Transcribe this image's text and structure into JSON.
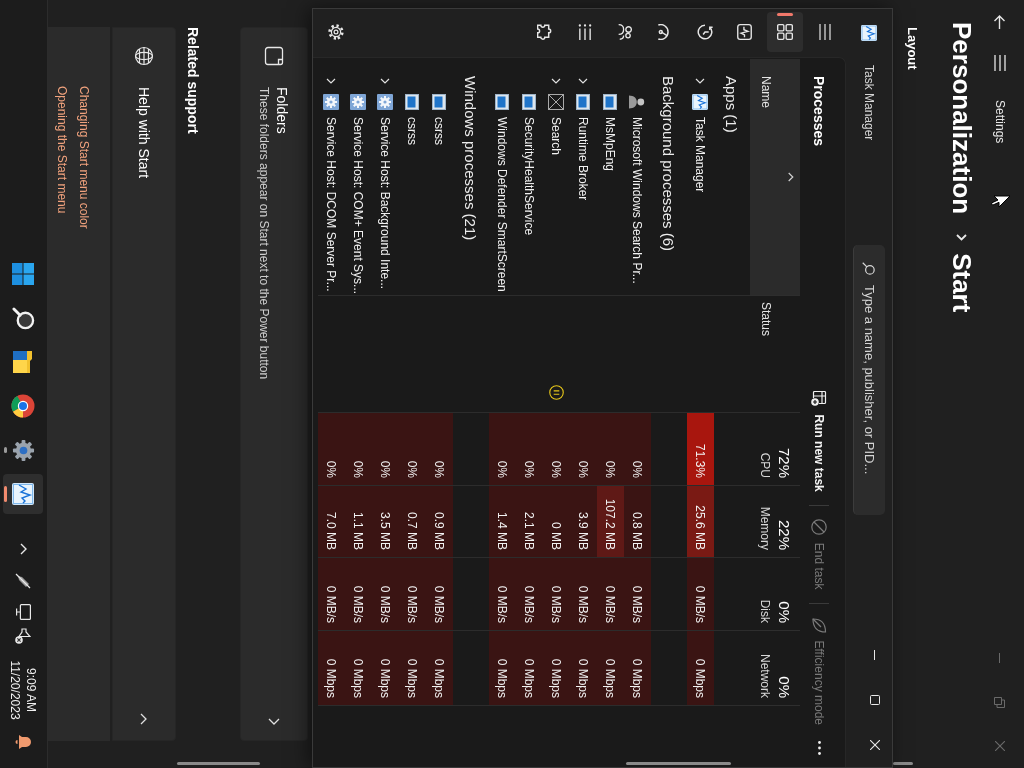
{
  "settings_window": {
    "title": "Settings",
    "breadcrumb": {
      "parent": "Personalization",
      "current": "Start"
    },
    "section_heading": "Layout",
    "folders_card": {
      "title": "Folders",
      "description": "These folders appear on Start next to the Power button"
    },
    "related_heading": "Related support",
    "help_card": {
      "title": "Help with Start",
      "expanded": true,
      "links": [
        "Changing Start menu color",
        "Opening the Start menu"
      ]
    }
  },
  "task_manager": {
    "title": "Task Manager",
    "search": {
      "placeholder": "Type a name, publisher, or PID..."
    },
    "nav": [
      {
        "selected": true
      },
      {
        "selected": false
      },
      {
        "selected": false
      },
      {
        "selected": false
      },
      {
        "selected": false
      },
      {
        "selected": false
      },
      {
        "selected": false
      },
      {
        "selected": false
      }
    ],
    "page_title": "Processes",
    "toolbar": [
      {
        "label": "Run new task",
        "disabled": false
      },
      {
        "label": "End task",
        "disabled": true
      },
      {
        "label": "Efficiency mode",
        "disabled": true
      }
    ],
    "columns": [
      {
        "label": "Name",
        "sorted": true
      },
      {
        "label": "Status",
        "sorted": false
      },
      {
        "label": "CPU",
        "total": "72%",
        "sorted": false
      },
      {
        "label": "Memory",
        "total": "22%",
        "sorted": false
      },
      {
        "label": "Disk",
        "total": "0%",
        "sorted": false
      },
      {
        "label": "Network",
        "total": "0%",
        "sorted": false
      }
    ],
    "groups": [
      {
        "label": "Apps (1)",
        "rows": [
          {
            "name": "Task Manager",
            "kind": "chart",
            "expandable": true,
            "suspended": false,
            "values": [
              {
                "text": "71.3%",
                "color": "#a8160e"
              },
              {
                "text": "25.6 MB",
                "color": "#7a1a14"
              },
              {
                "text": "0 MB/s",
                "color": "#3a1413"
              },
              {
                "text": "0 Mbps",
                "color": "#3a1413"
              }
            ]
          }
        ]
      },
      {
        "label": "Background processes (6)",
        "rows": [
          {
            "name": "Microsoft Windows Search Pr...",
            "kind": "person",
            "expandable": false,
            "suspended": false,
            "values": [
              {
                "text": "0%",
                "color": "#3a1413"
              },
              {
                "text": "0.8 MB",
                "color": "#3a1413"
              },
              {
                "text": "0 MB/s",
                "color": "#3a1413"
              },
              {
                "text": "0 Mbps",
                "color": "#3a1413"
              }
            ]
          },
          {
            "name": "MsMpEng",
            "kind": "window",
            "expandable": false,
            "suspended": false,
            "values": [
              {
                "text": "0%",
                "color": "#3a1413"
              },
              {
                "text": "107.2 MB",
                "color": "#5f1916"
              },
              {
                "text": "0 MB/s",
                "color": "#3a1413"
              },
              {
                "text": "0 Mbps",
                "color": "#3a1413"
              }
            ]
          },
          {
            "name": "Runtime Broker",
            "kind": "window",
            "expandable": true,
            "suspended": false,
            "values": [
              {
                "text": "0%",
                "color": "#3a1413"
              },
              {
                "text": "3.9 MB",
                "color": "#3a1413"
              },
              {
                "text": "0 MB/s",
                "color": "#3a1413"
              },
              {
                "text": "0 Mbps",
                "color": "#3a1413"
              }
            ]
          },
          {
            "name": "Search",
            "kind": "missing",
            "expandable": true,
            "suspended": true,
            "values": [
              {
                "text": "0%",
                "color": "#3a1413"
              },
              {
                "text": "0 MB",
                "color": "#3a1413"
              },
              {
                "text": "0 MB/s",
                "color": "#3a1413"
              },
              {
                "text": "0 Mbps",
                "color": "#3a1413"
              }
            ]
          },
          {
            "name": "SecurityHealthService",
            "kind": "window",
            "expandable": false,
            "suspended": false,
            "values": [
              {
                "text": "0%",
                "color": "#3a1413"
              },
              {
                "text": "2.1 MB",
                "color": "#3a1413"
              },
              {
                "text": "0 MB/s",
                "color": "#3a1413"
              },
              {
                "text": "0 Mbps",
                "color": "#3a1413"
              }
            ]
          },
          {
            "name": "Windows Defender SmartScreen",
            "kind": "window",
            "expandable": false,
            "suspended": false,
            "values": [
              {
                "text": "0%",
                "color": "#3a1413"
              },
              {
                "text": "1.4 MB",
                "color": "#3a1413"
              },
              {
                "text": "0 MB/s",
                "color": "#3a1413"
              },
              {
                "text": "0 Mbps",
                "color": "#3a1413"
              }
            ]
          }
        ]
      },
      {
        "label": "Windows processes (21)",
        "rows": [
          {
            "name": "csrss",
            "kind": "window",
            "expandable": false,
            "suspended": false,
            "values": [
              {
                "text": "0%",
                "color": "#3a1413"
              },
              {
                "text": "0.9 MB",
                "color": "#3a1413"
              },
              {
                "text": "0 MB/s",
                "color": "#3a1413"
              },
              {
                "text": "0 Mbps",
                "color": "#3a1413"
              }
            ]
          },
          {
            "name": "csrss",
            "kind": "window",
            "expandable": false,
            "suspended": false,
            "values": [
              {
                "text": "0%",
                "color": "#3a1413"
              },
              {
                "text": "0.7 MB",
                "color": "#3a1413"
              },
              {
                "text": "0 MB/s",
                "color": "#3a1413"
              },
              {
                "text": "0 Mbps",
                "color": "#3a1413"
              }
            ]
          },
          {
            "name": "Service Host: Background Inte...",
            "kind": "service",
            "expandable": true,
            "suspended": false,
            "values": [
              {
                "text": "0%",
                "color": "#3a1413"
              },
              {
                "text": "3.5 MB",
                "color": "#3a1413"
              },
              {
                "text": "0 MB/s",
                "color": "#3a1413"
              },
              {
                "text": "0 Mbps",
                "color": "#3a1413"
              }
            ]
          },
          {
            "name": "Service Host: COM+ Event Sys...",
            "kind": "service",
            "expandable": false,
            "suspended": false,
            "values": [
              {
                "text": "0%",
                "color": "#3a1413"
              },
              {
                "text": "1.1 MB",
                "color": "#3a1413"
              },
              {
                "text": "0 MB/s",
                "color": "#3a1413"
              },
              {
                "text": "0 Mbps",
                "color": "#3a1413"
              }
            ]
          },
          {
            "name": "Service Host: DCOM Server Pr...",
            "kind": "service",
            "expandable": true,
            "suspended": false,
            "values": [
              {
                "text": "0%",
                "color": "#3a1413"
              },
              {
                "text": "7.0 MB",
                "color": "#3a1413"
              },
              {
                "text": "0 MB/s",
                "color": "#3a1413"
              },
              {
                "text": "0 Mbps",
                "color": "#3a1413"
              }
            ]
          }
        ]
      }
    ]
  },
  "taskbar": {
    "apps": [
      {
        "running": false,
        "active": false
      },
      {
        "running": false,
        "active": false
      },
      {
        "running": false,
        "active": false
      },
      {
        "running": false,
        "active": false
      },
      {
        "running": true,
        "active": false
      },
      {
        "running": true,
        "active": true
      }
    ],
    "time": "9:09 AM",
    "date": "11/20/2023"
  }
}
